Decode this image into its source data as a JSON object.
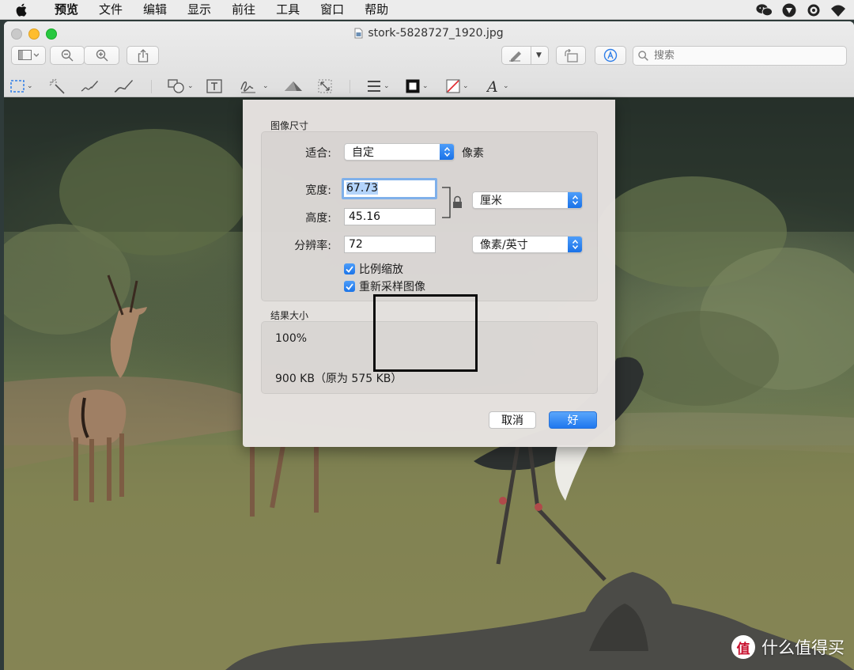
{
  "menubar": {
    "items": [
      "预览",
      "文件",
      "编辑",
      "显示",
      "前往",
      "工具",
      "窗口",
      "帮助"
    ],
    "tray_icons": [
      "wechat-icon",
      "vpn-icon",
      "sync-icon",
      "wifi-icon"
    ]
  },
  "window": {
    "title": "stork-5828727_1920.jpg",
    "search": {
      "placeholder": "搜索"
    }
  },
  "dialog": {
    "image_size_label": "图像尺寸",
    "fit_label": "适合:",
    "fit_value": "自定",
    "fit_unit": "像素",
    "width_label": "宽度:",
    "width_value": "67.73",
    "height_label": "高度:",
    "height_value": "45.16",
    "size_unit": "厘米",
    "resolution_label": "分辨率:",
    "resolution_value": "72",
    "resolution_unit": "像素/英寸",
    "scale_proportionally": "比例缩放",
    "resample_image": "重新采样图像",
    "result_size_label": "结果大小",
    "result_percent": "100%",
    "result_size": "900 KB（原为 575 KB）",
    "cancel_label": "取消",
    "ok_label": "好"
  },
  "watermark": {
    "text": "什么值得买",
    "logo": "值"
  },
  "colors": {
    "accent": "#1f77ee",
    "focus_ring": "#7fb0ea",
    "selection": "#b4d4fb"
  }
}
